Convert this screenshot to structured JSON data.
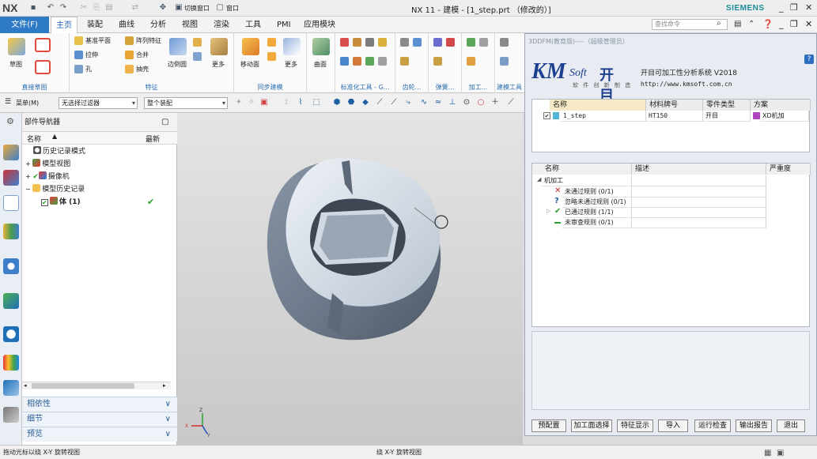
{
  "app": {
    "logo": "NX",
    "title": "NX 11 - 建模 - [1_step.prt （修改的）]",
    "brand": "SIEMENS",
    "switch_window": "切换窗口",
    "window_menu": "窗口"
  },
  "tabs": [
    "主页",
    "装配",
    "曲线",
    "分析",
    "视图",
    "渲染",
    "工具",
    "PMI",
    "应用模块"
  ],
  "file_tab": "文件(F)",
  "search_placeholder": "查找命令",
  "ribbon": {
    "groups": [
      "直接草图",
      "特征",
      "同步建模",
      "标准化工具 - G...",
      "齿轮...",
      "弹簧...",
      "加工...",
      "建模工具"
    ],
    "sketch": "草图",
    "datum_plane": "基准平面",
    "extrude": "拉伸",
    "hole": "孔",
    "pattern": "阵列特征",
    "unite": "合并",
    "shell": "抽壳",
    "edge_blend": "边倒圆",
    "more": "更多",
    "move_face": "移动面",
    "surface": "曲面"
  },
  "filterbar": {
    "menu": "菜单(M)",
    "filter": "无选择过滤器",
    "scope": "整个装配"
  },
  "navigator": {
    "title": "部件导航器",
    "col_name": "名称",
    "col_latest": "最新",
    "rows": [
      {
        "label": "历史记录模式"
      },
      {
        "label": "模型视图"
      },
      {
        "label": "摄像机"
      },
      {
        "label": "模型历史记录"
      },
      {
        "label": "体 (1)"
      }
    ],
    "accordion": [
      "相依性",
      "细节",
      "预览"
    ]
  },
  "dialog": {
    "title": "3DDFM(教育版)----（超级管理员）",
    "logo_km": "KM",
    "logo_soft": "Soft",
    "logo_cn": "开目",
    "slogan": "软 件 创 新 制 造",
    "system": "开目可加工性分析系统 V2018",
    "url": "http://www.kmsoft.com.cn",
    "part_headers": [
      "名称",
      "材料牌号",
      "零件类型",
      "方案"
    ],
    "part_row": {
      "name": "1_step",
      "material": "HT150",
      "type": "开目",
      "plan": "XD机加"
    },
    "rule_headers": [
      "名称",
      "描述",
      "严重度"
    ],
    "rules": [
      {
        "label": "机加工"
      },
      {
        "label": "未通过规则 (0/1)"
      },
      {
        "label": "忽略未通过规则 (0/1)"
      },
      {
        "label": "已通过规则 (1/1)"
      },
      {
        "label": "未审查规则 (0/1)"
      }
    ],
    "buttons": [
      "预配置",
      "加工面选择",
      "特征显示",
      "导入",
      "运行检查",
      "输出报告",
      "退出"
    ]
  },
  "status": {
    "left": "拖动光标以绕 X-Y 旋转视图",
    "center": "绕 X-Y 旋转视图"
  },
  "colors": {
    "accent": "#2e7ac4",
    "check": "#2aa02a",
    "error": "#c62828"
  }
}
